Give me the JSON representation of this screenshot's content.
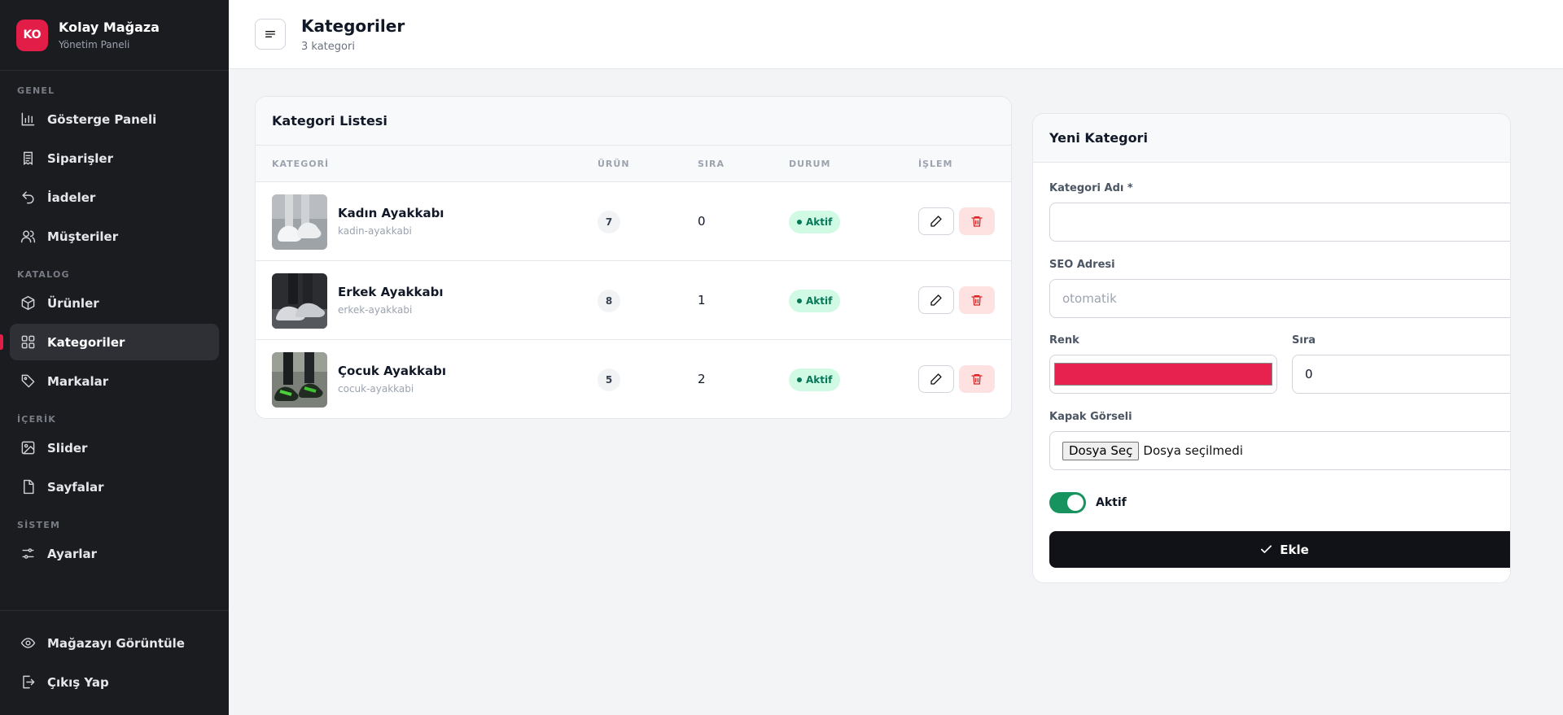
{
  "brand": {
    "initials": "KO",
    "name": "Kolay Mağaza",
    "subtitle": "Yönetim Paneli",
    "accent": "#e11d48"
  },
  "sidebar": {
    "sections": {
      "genel": "GENEL",
      "katalog": "KATALOG",
      "icerik": "İÇERİK",
      "sistem": "SİSTEM"
    },
    "items": {
      "dashboard": "Gösterge Paneli",
      "orders": "Siparişler",
      "returns": "İadeler",
      "customers": "Müşteriler",
      "products": "Ürünler",
      "categories": "Kategoriler",
      "brands": "Markalar",
      "slider": "Slider",
      "pages": "Sayfalar",
      "settings": "Ayarlar"
    },
    "bottom": {
      "view_store": "Mağazayı Görüntüle",
      "logout": "Çıkış Yap"
    },
    "active": "categories"
  },
  "header": {
    "title": "Kategoriler",
    "subtitle": "3 kategori"
  },
  "list": {
    "title": "Kategori Listesi",
    "columns": {
      "category": "KATEGORİ",
      "products": "ÜRÜN",
      "order": "SIRA",
      "status": "DURUM",
      "actions": "İŞLEM"
    },
    "rows": [
      {
        "name": "Kadın Ayakkabı",
        "slug": "kadin-ayakkabi",
        "count": "7",
        "order": "0",
        "status": "Aktif"
      },
      {
        "name": "Erkek Ayakkabı",
        "slug": "erkek-ayakkabi",
        "count": "8",
        "order": "1",
        "status": "Aktif"
      },
      {
        "name": "Çocuk Ayakkabı",
        "slug": "cocuk-ayakkabi",
        "count": "5",
        "order": "2",
        "status": "Aktif"
      }
    ]
  },
  "form": {
    "title": "Yeni Kategori",
    "name_label": "Kategori Adı *",
    "name_value": "",
    "seo_label": "SEO Adresi",
    "seo_placeholder": "otomatik",
    "color_label": "Renk",
    "color_value": "#e8224f",
    "order_label": "Sıra",
    "order_value": "0",
    "image_label": "Kapak Görseli",
    "file_button": "Dosya Seç",
    "file_status": "Dosya seçilmedi",
    "active_label": "Aktif",
    "active": true,
    "submit_label": "Ekle"
  }
}
